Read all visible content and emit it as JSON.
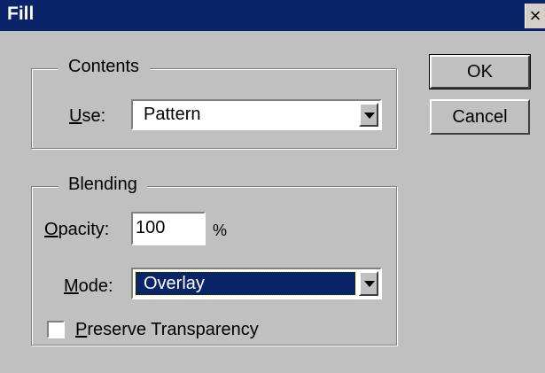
{
  "window": {
    "title": "Fill",
    "close_glyph": "×"
  },
  "contents": {
    "legend": "Contents",
    "use_label_mnemonic": "U",
    "use_label_rest": "se:",
    "use_value": "Pattern"
  },
  "blending": {
    "legend": "Blending",
    "opacity_label_mnemonic": "O",
    "opacity_label_rest": "pacity:",
    "opacity_value": "100",
    "opacity_unit": "%",
    "mode_label_mnemonic": "M",
    "mode_label_rest": "ode:",
    "mode_value": "Overlay",
    "preserve_mnemonic": "P",
    "preserve_rest": "reserve Transparency",
    "preserve_checked": false
  },
  "buttons": {
    "ok": "OK",
    "cancel": "Cancel"
  },
  "colors": {
    "titlebar": "#0a246a",
    "face": "#c0c0c0",
    "selection": "#0a246a"
  }
}
